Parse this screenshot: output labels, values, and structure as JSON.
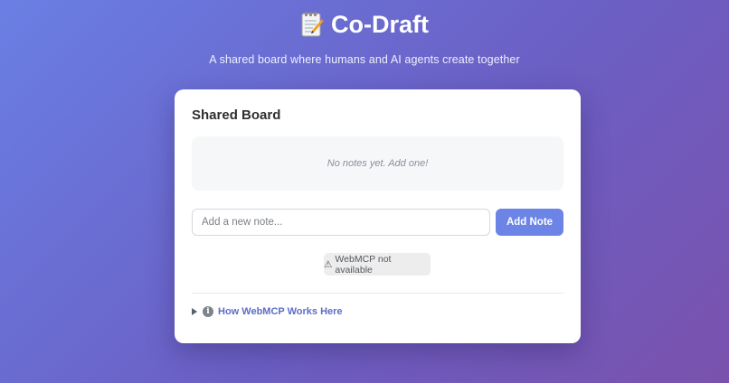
{
  "header": {
    "icon": "memo-icon",
    "title": "Co-Draft",
    "subtitle": "A shared board where humans and AI agents create together"
  },
  "board": {
    "title": "Shared Board",
    "empty_message": "No notes yet. Add one!",
    "input": {
      "value": "",
      "placeholder": "Add a new note..."
    },
    "add_button_label": "Add Note",
    "status": {
      "icon": "warning-icon",
      "icon_glyph": "⚠",
      "text": "WebMCP not available"
    },
    "details": {
      "icon": "info-icon",
      "icon_glyph": "i",
      "label": "How WebMCP Works Here"
    }
  },
  "colors": {
    "accent": "#6b84e6",
    "link": "#5b6dc7",
    "background_start": "#6a7fe4",
    "background_end": "#7a52ad"
  }
}
